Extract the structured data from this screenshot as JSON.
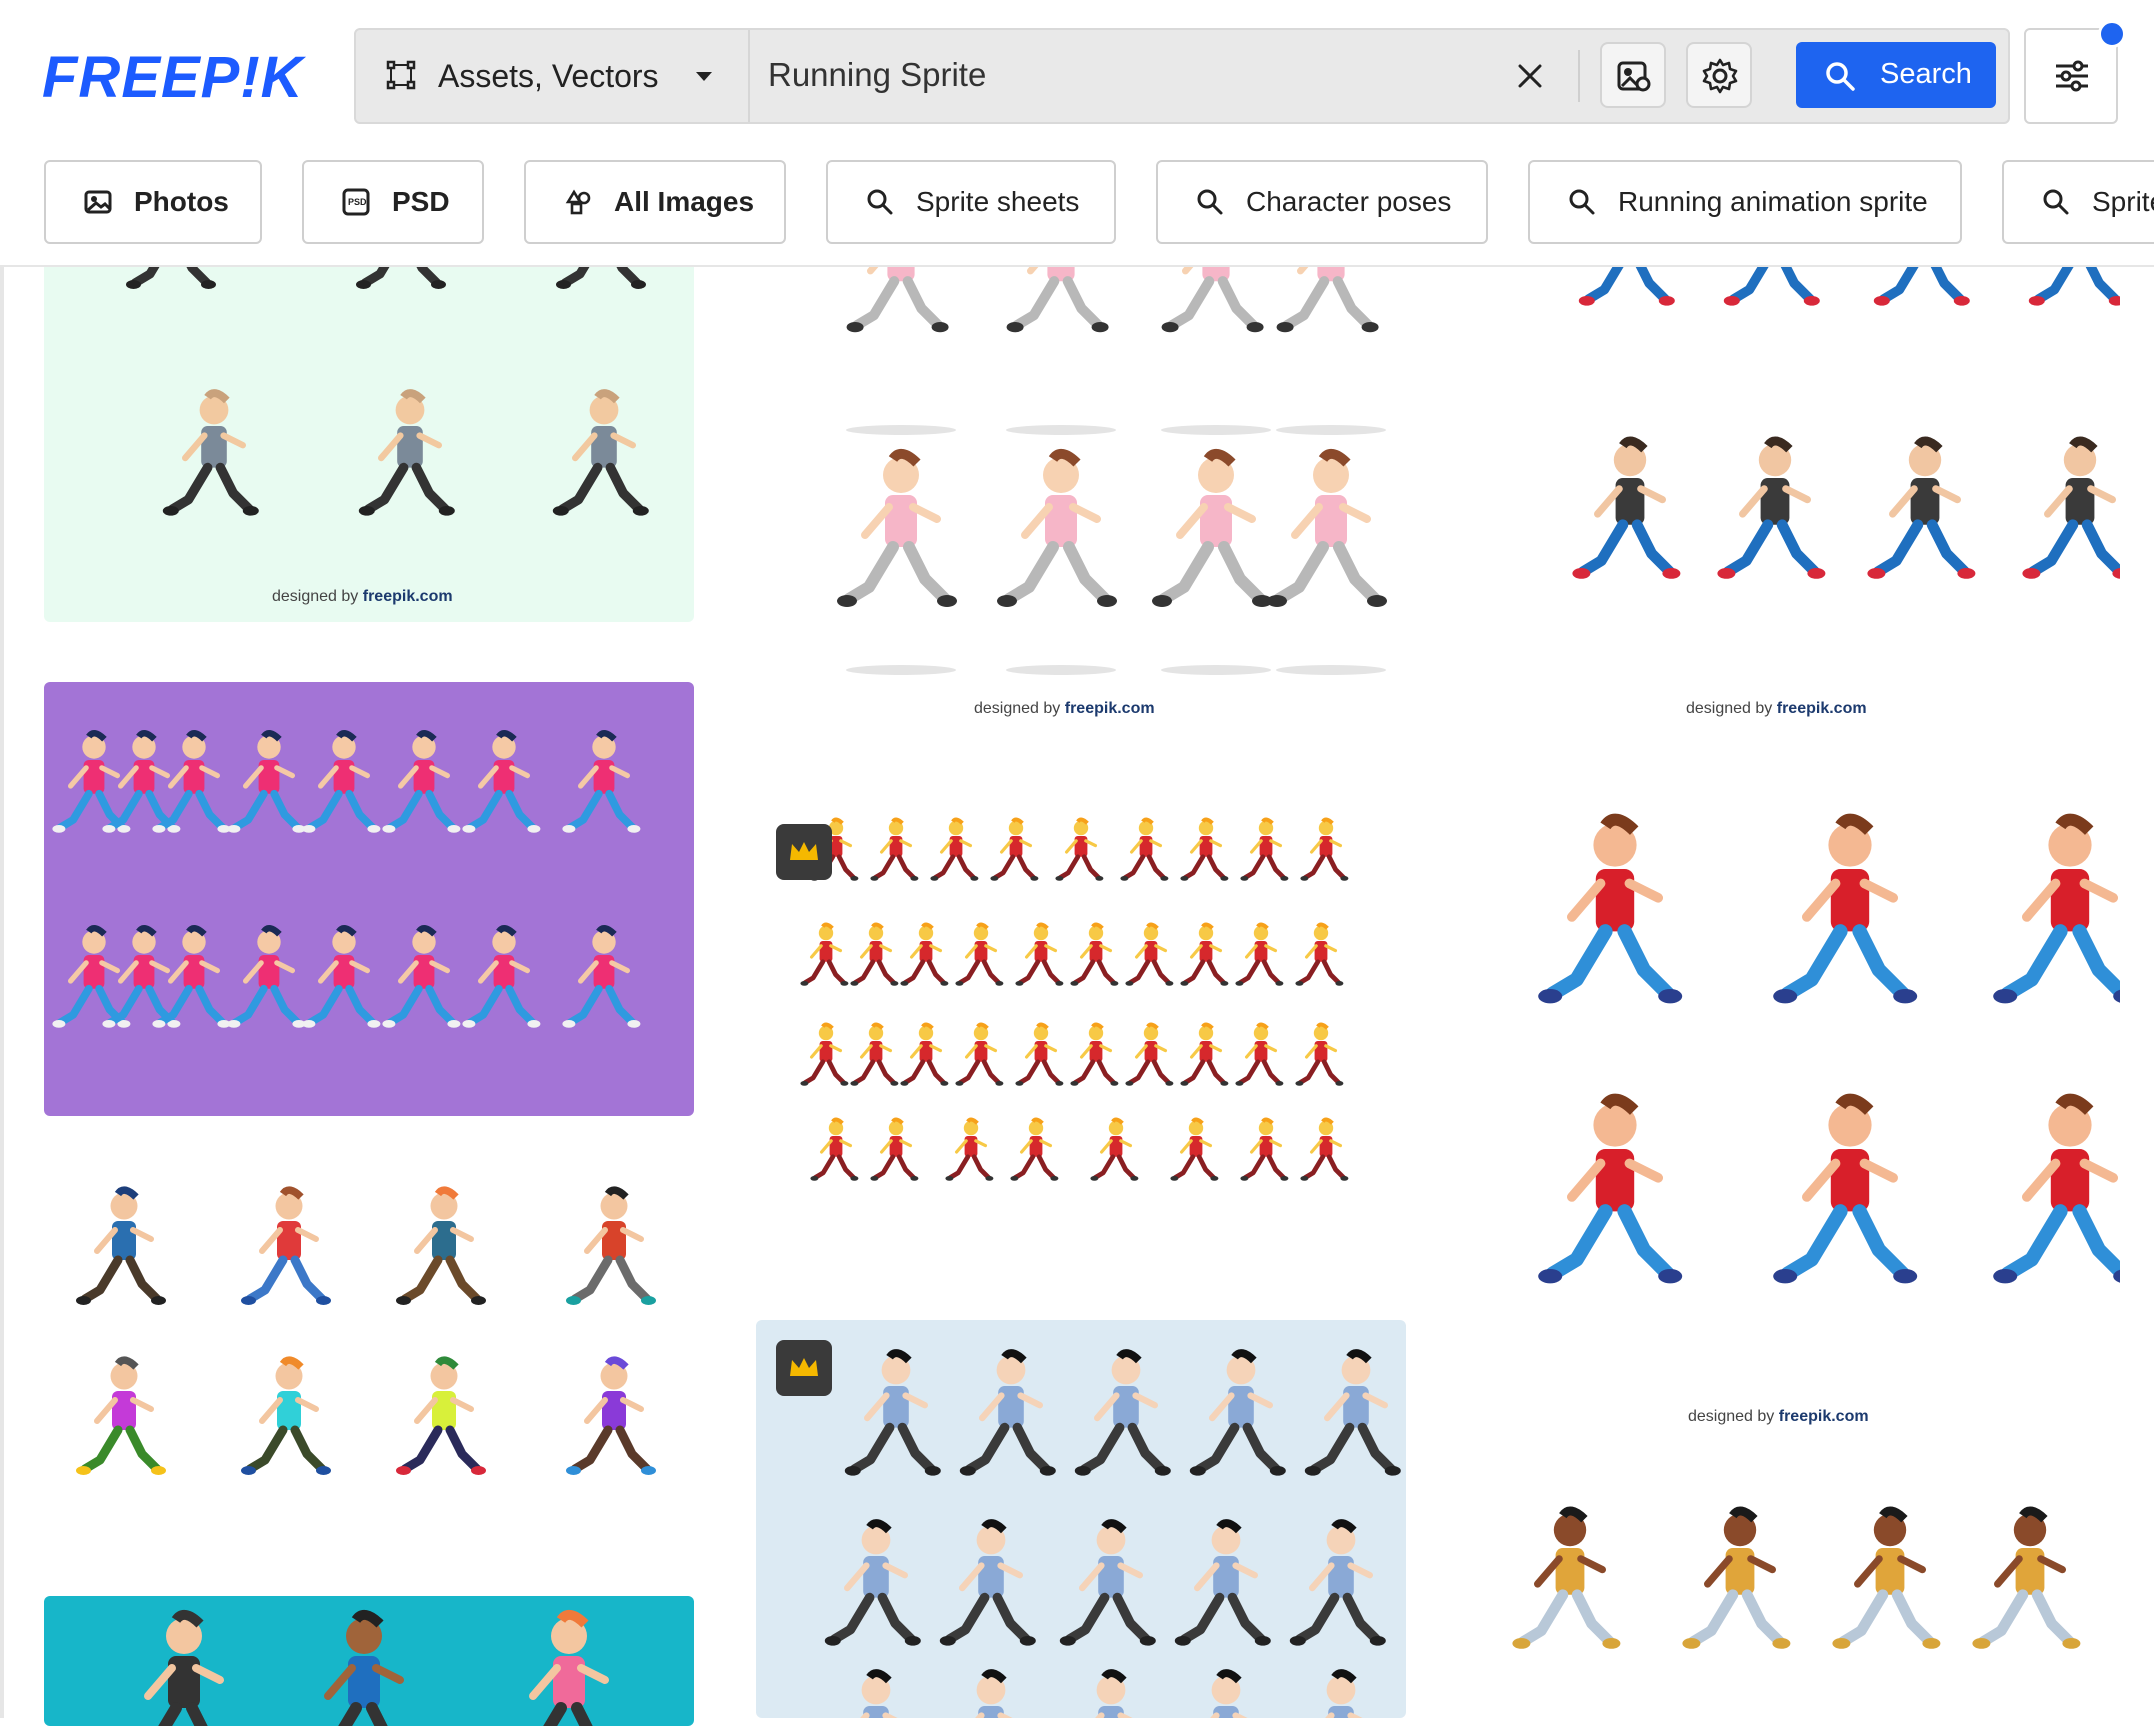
{
  "brand": {
    "logo_text": "FREEP!K",
    "accent": "#1E64F0"
  },
  "search": {
    "asset_type": "Assets, Vectors",
    "query": "Running Sprite",
    "search_label": "Search"
  },
  "chips": [
    {
      "label": "Photos",
      "icon": "image-icon"
    },
    {
      "label": "PSD",
      "icon": "psd-file-icon"
    },
    {
      "label": "All Images",
      "icon": "shapes-icon"
    },
    {
      "label": "Sprite sheets",
      "icon": "search-icon"
    },
    {
      "label": "Character poses",
      "icon": "search-icon"
    },
    {
      "label": "Running animation sprite",
      "icon": "search-icon"
    },
    {
      "label": "Sprite",
      "icon": "search-icon"
    }
  ],
  "results": {
    "credit_prefix": "designed by",
    "credit_site": "freepik.com",
    "items": [
      {
        "name": "athletes-running-mint",
        "bg": "#E8FBF1"
      },
      {
        "name": "girl-runner-cycle",
        "bg": "#FFFFFF"
      },
      {
        "name": "man-blue-jeans-run-cycle",
        "bg": "#FFFFFF"
      },
      {
        "name": "girl-walk-cycle-purple",
        "bg": "#A374D6"
      },
      {
        "name": "robot-hero-sprite-sheet",
        "bg": "#FFFFFF",
        "premium": true
      },
      {
        "name": "man-red-shirt-run-cycle",
        "bg": "#FFFFFF"
      },
      {
        "name": "kids-running-set",
        "bg": "#FFFFFF"
      },
      {
        "name": "boy-with-bar-sprites",
        "bg": "#DCEAF3",
        "premium": true
      },
      {
        "name": "people-waving-teal",
        "bg": "#17B6C9"
      },
      {
        "name": "woman-running-cycle",
        "bg": "#FFFFFF"
      }
    ]
  }
}
